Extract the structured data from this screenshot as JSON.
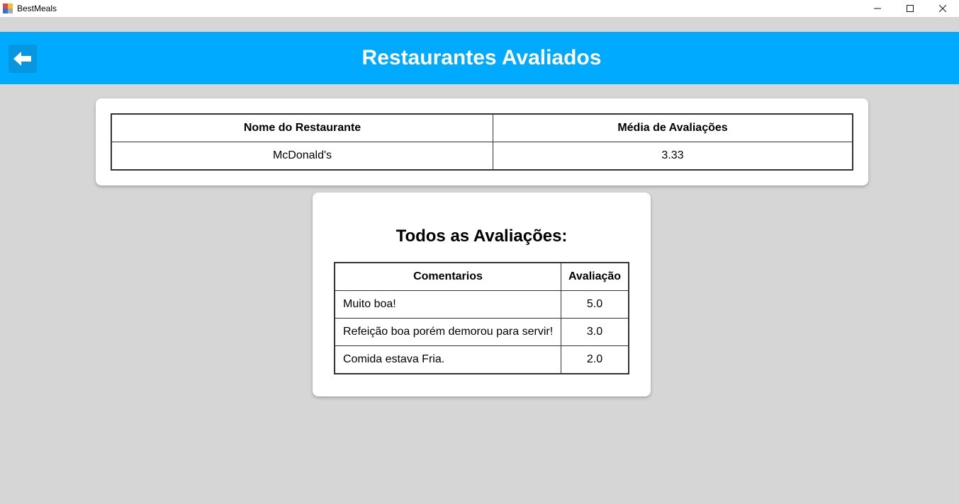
{
  "window": {
    "title": "BestMeals",
    "minimize_icon": "minimize-icon",
    "maximize_icon": "maximize-icon",
    "close_icon": "close-icon"
  },
  "header": {
    "title": "Restaurantes Avaliados",
    "back_icon": "arrow-left-icon",
    "background_color": "#00aaff"
  },
  "summary": {
    "columns": [
      "Nome do Restaurante",
      "Média de Avaliações"
    ],
    "rows": [
      {
        "name": "McDonald's",
        "average": "3.33"
      }
    ]
  },
  "reviews": {
    "title": "Todos as Avaliações:",
    "columns": [
      "Comentarios",
      "Avaliação"
    ],
    "rows": [
      {
        "comment": "Muito boa!",
        "rating": "5.0"
      },
      {
        "comment": "Refeição boa porém demorou para servir!",
        "rating": "3.0"
      },
      {
        "comment": "Comida estava Fria.",
        "rating": "2.0"
      }
    ]
  }
}
